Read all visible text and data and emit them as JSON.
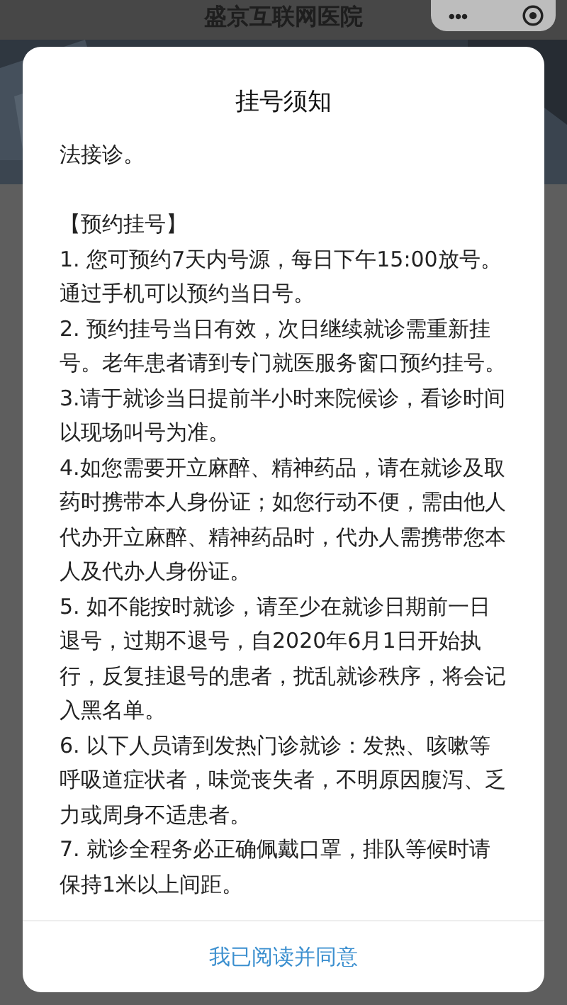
{
  "app_bar": {
    "title": "盛京互联网医院",
    "menu_glyph": "•••"
  },
  "dialog": {
    "title": "挂号须知",
    "paragraphs": [
      {
        "kind": "text",
        "text": "法接诊。"
      },
      {
        "kind": "gap"
      },
      {
        "kind": "text",
        "text": "【预约挂号】"
      },
      {
        "kind": "text",
        "text": "1.  您可预约7天内号源，每日下午15:00放号。通过手机可以预约当日号。"
      },
      {
        "kind": "text",
        "text": "2. 预约挂号当日有效，次日继续就诊需重新挂号。老年患者请到专门就医服务窗口预约挂号。"
      },
      {
        "kind": "text",
        "text": "3.请于就诊当日提前半小时来院候诊，看诊时间以现场叫号为准。"
      },
      {
        "kind": "text",
        "text": "4.如您需要开立麻醉、精神药品，请在就诊及取药时携带本人身份证；如您行动不便，需由他人代办开立麻醉、精神药品时，代办人需携带您本人及代办人身份证。"
      },
      {
        "kind": "text",
        "text": "5. 如不能按时就诊，请至少在就诊日期前一日退号，过期不退号，自2020年6月1日开始执行，反复挂退号的患者，扰乱就诊秩序，将会记入黑名单。"
      },
      {
        "kind": "text",
        "text": "6.    以下人员请到发热门诊就诊：发热、咳嗽等呼吸道症状者，味觉丧失者，不明原因腹泻、乏力或周身不适患者。"
      },
      {
        "kind": "text",
        "text": "7. 就诊全程务必正确佩戴口罩，排队等候时请保持1米以上间距。"
      }
    ],
    "confirm_button": "我已阅读并同意"
  }
}
